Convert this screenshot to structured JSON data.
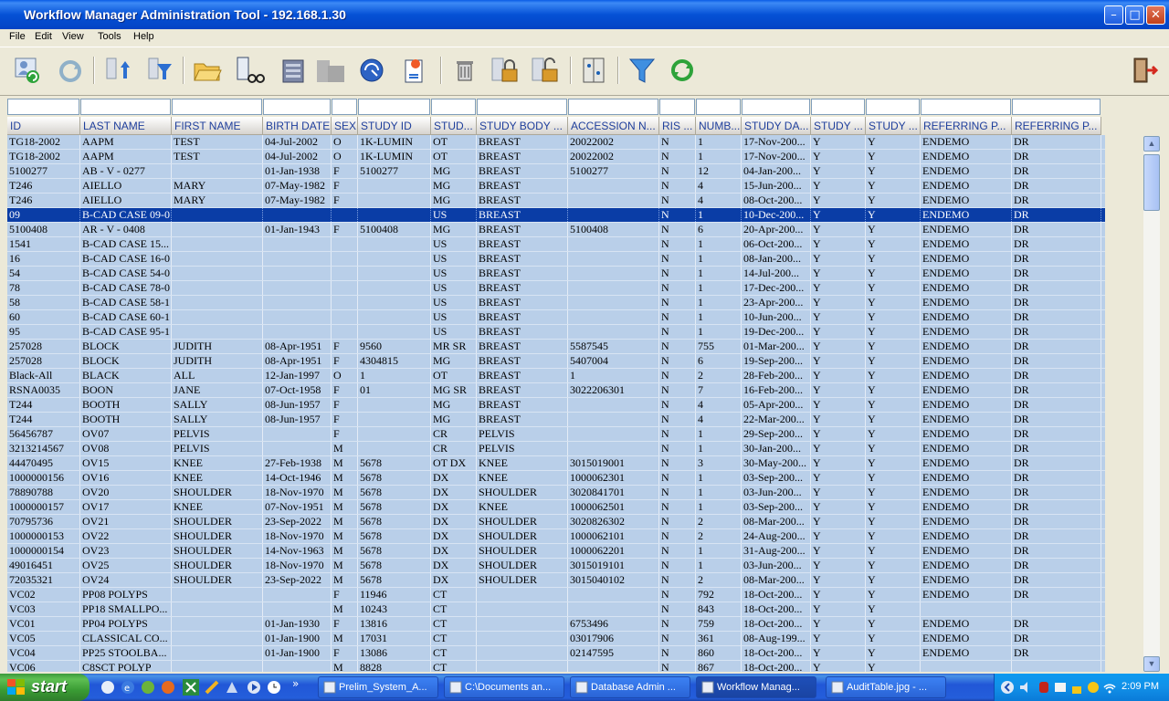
{
  "window": {
    "title": "Workflow Manager Administration Tool - 192.168.1.30"
  },
  "menu": [
    "File",
    "Edit",
    "View",
    "Tools",
    "Help"
  ],
  "toolbar_icons": [
    "user-refresh-icon",
    "refresh-icon",
    "sort-up-icon",
    "filter-user-icon",
    "folder-open-icon",
    "search-list-icon",
    "server-icon",
    "server-disabled-icon",
    "network-icon",
    "document-new-icon",
    "trash-icon",
    "lock-icon",
    "unlock-icon",
    "panel-icon",
    "funnel-icon",
    "reload-icon",
    "exit-icon"
  ],
  "columns": [
    "ID",
    "LAST NAME",
    "FIRST NAME",
    "BIRTH DATE",
    "SEX",
    "STUDY ID",
    "STUD...",
    "STUDY BODY ...",
    "ACCESSION N...",
    "RIS ...",
    "NUMB...",
    "STUDY DA...",
    "STUDY ...",
    "STUDY ...",
    "REFERRING P...",
    "REFERRING P..."
  ],
  "rows": [
    [
      "TG18-2002",
      "AAPM",
      "TEST",
      "04-Jul-2002",
      "O",
      "1K-LUMIN",
      "OT",
      "BREAST",
      "20022002",
      "N",
      "1",
      "17-Nov-200...",
      "Y",
      "Y",
      "ENDEMO",
      "DR"
    ],
    [
      "TG18-2002",
      "AAPM",
      "TEST",
      "04-Jul-2002",
      "O",
      "1K-LUMIN",
      "OT",
      "BREAST",
      "20022002",
      "N",
      "1",
      "17-Nov-200...",
      "Y",
      "Y",
      "ENDEMO",
      "DR"
    ],
    [
      "5100277",
      "AB - V - 0277",
      "",
      "01-Jan-1938",
      "F",
      "5100277",
      "MG",
      "BREAST",
      "5100277",
      "N",
      "12",
      "04-Jan-200...",
      "Y",
      "Y",
      "ENDEMO",
      "DR"
    ],
    [
      "T246",
      "AIELLO",
      "MARY",
      "07-May-1982",
      "F",
      "",
      "MG",
      "BREAST",
      "",
      "N",
      "4",
      "15-Jun-200...",
      "Y",
      "Y",
      "ENDEMO",
      "DR"
    ],
    [
      "T246",
      "AIELLO",
      "MARY",
      "07-May-1982",
      "F",
      "",
      "MG",
      "BREAST",
      "",
      "N",
      "4",
      "08-Oct-200...",
      "Y",
      "Y",
      "ENDEMO",
      "DR"
    ],
    [
      "09",
      "B-CAD CASE 09-0",
      "",
      "",
      "",
      "",
      "US",
      "BREAST",
      "",
      "N",
      "1",
      "10-Dec-200...",
      "Y",
      "Y",
      "ENDEMO",
      "DR"
    ],
    [
      "5100408",
      "AR - V - 0408",
      "",
      "01-Jan-1943",
      "F",
      "5100408",
      "MG",
      "BREAST",
      "5100408",
      "N",
      "6",
      "20-Apr-200...",
      "Y",
      "Y",
      "ENDEMO",
      "DR"
    ],
    [
      "1541",
      "B-CAD CASE 15...",
      "",
      "",
      "",
      "",
      "US",
      "BREAST",
      "",
      "N",
      "1",
      "06-Oct-200...",
      "Y",
      "Y",
      "ENDEMO",
      "DR"
    ],
    [
      "16",
      "B-CAD CASE 16-0",
      "",
      "",
      "",
      "",
      "US",
      "BREAST",
      "",
      "N",
      "1",
      "08-Jan-200...",
      "Y",
      "Y",
      "ENDEMO",
      "DR"
    ],
    [
      "54",
      "B-CAD CASE 54-0",
      "",
      "",
      "",
      "",
      "US",
      "BREAST",
      "",
      "N",
      "1",
      "14-Jul-200...",
      "Y",
      "Y",
      "ENDEMO",
      "DR"
    ],
    [
      "78",
      "B-CAD CASE 78-0",
      "",
      "",
      "",
      "",
      "US",
      "BREAST",
      "",
      "N",
      "1",
      "17-Dec-200...",
      "Y",
      "Y",
      "ENDEMO",
      "DR"
    ],
    [
      "58",
      "B-CAD CASE 58-1",
      "",
      "",
      "",
      "",
      "US",
      "BREAST",
      "",
      "N",
      "1",
      "23-Apr-200...",
      "Y",
      "Y",
      "ENDEMO",
      "DR"
    ],
    [
      "60",
      "B-CAD CASE 60-1",
      "",
      "",
      "",
      "",
      "US",
      "BREAST",
      "",
      "N",
      "1",
      "10-Jun-200...",
      "Y",
      "Y",
      "ENDEMO",
      "DR"
    ],
    [
      "95",
      "B-CAD CASE 95-1",
      "",
      "",
      "",
      "",
      "US",
      "BREAST",
      "",
      "N",
      "1",
      "19-Dec-200...",
      "Y",
      "Y",
      "ENDEMO",
      "DR"
    ],
    [
      "257028",
      "BLOCK",
      "JUDITH",
      "08-Apr-1951",
      "F",
      "9560",
      "MR SR",
      "BREAST",
      "5587545",
      "N",
      "755",
      "01-Mar-200...",
      "Y",
      "Y",
      "ENDEMO",
      "DR"
    ],
    [
      "257028",
      "BLOCK",
      "JUDITH",
      "08-Apr-1951",
      "F",
      "4304815",
      "MG",
      "BREAST",
      "5407004",
      "N",
      "6",
      "19-Sep-200...",
      "Y",
      "Y",
      "ENDEMO",
      "DR"
    ],
    [
      "Black-All",
      "BLACK",
      "ALL",
      "12-Jan-1997",
      "O",
      "1",
      "OT",
      "BREAST",
      "1",
      "N",
      "2",
      "28-Feb-200...",
      "Y",
      "Y",
      "ENDEMO",
      "DR"
    ],
    [
      "RSNA0035",
      "BOON",
      "JANE",
      "07-Oct-1958",
      "F",
      "01",
      "MG SR",
      "BREAST",
      "3022206301",
      "N",
      "7",
      "16-Feb-200...",
      "Y",
      "Y",
      "ENDEMO",
      "DR"
    ],
    [
      "T244",
      "BOOTH",
      "SALLY",
      "08-Jun-1957",
      "F",
      "",
      "MG",
      "BREAST",
      "",
      "N",
      "4",
      "05-Apr-200...",
      "Y",
      "Y",
      "ENDEMO",
      "DR"
    ],
    [
      "T244",
      "BOOTH",
      "SALLY",
      "08-Jun-1957",
      "F",
      "",
      "MG",
      "BREAST",
      "",
      "N",
      "4",
      "22-Mar-200...",
      "Y",
      "Y",
      "ENDEMO",
      "DR"
    ],
    [
      "56456787",
      "OV07",
      "PELVIS",
      "",
      "F",
      "",
      "CR",
      "PELVIS",
      "",
      "N",
      "1",
      "29-Sep-200...",
      "Y",
      "Y",
      "ENDEMO",
      "DR"
    ],
    [
      "3213214567",
      "OV08",
      "PELVIS",
      "",
      "M",
      "",
      "CR",
      "PELVIS",
      "",
      "N",
      "1",
      "30-Jan-200...",
      "Y",
      "Y",
      "ENDEMO",
      "DR"
    ],
    [
      "44470495",
      "OV15",
      "KNEE",
      "27-Feb-1938",
      "M",
      "5678",
      "OT DX",
      "KNEE",
      "3015019001",
      "N",
      "3",
      "30-May-200...",
      "Y",
      "Y",
      "ENDEMO",
      "DR"
    ],
    [
      "1000000156",
      "OV16",
      "KNEE",
      "14-Oct-1946",
      "M",
      "5678",
      "DX",
      "KNEE",
      "1000062301",
      "N",
      "1",
      "03-Sep-200...",
      "Y",
      "Y",
      "ENDEMO",
      "DR"
    ],
    [
      "78890788",
      "OV20",
      "SHOULDER",
      "18-Nov-1970",
      "M",
      "5678",
      "DX",
      "SHOULDER",
      "3020841701",
      "N",
      "1",
      "03-Jun-200...",
      "Y",
      "Y",
      "ENDEMO",
      "DR"
    ],
    [
      "1000000157",
      "OV17",
      "KNEE",
      "07-Nov-1951",
      "M",
      "5678",
      "DX",
      "KNEE",
      "1000062501",
      "N",
      "1",
      "03-Sep-200...",
      "Y",
      "Y",
      "ENDEMO",
      "DR"
    ],
    [
      "70795736",
      "OV21",
      "SHOULDER",
      "23-Sep-2022",
      "M",
      "5678",
      "DX",
      "SHOULDER",
      "3020826302",
      "N",
      "2",
      "08-Mar-200...",
      "Y",
      "Y",
      "ENDEMO",
      "DR"
    ],
    [
      "1000000153",
      "OV22",
      "SHOULDER",
      "18-Nov-1970",
      "M",
      "5678",
      "DX",
      "SHOULDER",
      "1000062101",
      "N",
      "2",
      "24-Aug-200...",
      "Y",
      "Y",
      "ENDEMO",
      "DR"
    ],
    [
      "1000000154",
      "OV23",
      "SHOULDER",
      "14-Nov-1963",
      "M",
      "5678",
      "DX",
      "SHOULDER",
      "1000062201",
      "N",
      "1",
      "31-Aug-200...",
      "Y",
      "Y",
      "ENDEMO",
      "DR"
    ],
    [
      "49016451",
      "OV25",
      "SHOULDER",
      "18-Nov-1970",
      "M",
      "5678",
      "DX",
      "SHOULDER",
      "3015019101",
      "N",
      "1",
      "03-Jun-200...",
      "Y",
      "Y",
      "ENDEMO",
      "DR"
    ],
    [
      "72035321",
      "OV24",
      "SHOULDER",
      "23-Sep-2022",
      "M",
      "5678",
      "DX",
      "SHOULDER",
      "3015040102",
      "N",
      "2",
      "08-Mar-200...",
      "Y",
      "Y",
      "ENDEMO",
      "DR"
    ],
    [
      "VC02",
      "PP08 POLYPS",
      "",
      "",
      "F",
      "11946",
      "CT",
      "",
      "",
      "N",
      "792",
      "18-Oct-200...",
      "Y",
      "Y",
      "ENDEMO",
      "DR"
    ],
    [
      "VC03",
      "PP18 SMALLPO...",
      "",
      "",
      "M",
      "10243",
      "CT",
      "",
      "",
      "N",
      "843",
      "18-Oct-200...",
      "Y",
      "Y",
      "",
      ""
    ],
    [
      "VC01",
      "PP04 POLYPS",
      "",
      "01-Jan-1930",
      "F",
      "13816",
      "CT",
      "",
      "6753496",
      "N",
      "759",
      "18-Oct-200...",
      "Y",
      "Y",
      "ENDEMO",
      "DR"
    ],
    [
      "VC05",
      "CLASSICAL CO...",
      "",
      "01-Jan-1900",
      "M",
      "17031",
      "CT",
      "",
      "03017906",
      "N",
      "361",
      "08-Aug-199...",
      "Y",
      "Y",
      "ENDEMO",
      "DR"
    ],
    [
      "VC04",
      "PP25 STOOLBA...",
      "",
      "01-Jan-1900",
      "F",
      "13086",
      "CT",
      "",
      "02147595",
      "N",
      "860",
      "18-Oct-200...",
      "Y",
      "Y",
      "ENDEMO",
      "DR"
    ],
    [
      "VC06",
      "C8SCT POLYP",
      "",
      "",
      "M",
      "8828",
      "CT",
      "",
      "",
      "N",
      "867",
      "18-Oct-200...",
      "Y",
      "Y",
      "",
      ""
    ]
  ],
  "selected_row_index": 5,
  "taskbar": {
    "start_label": "start",
    "tasks": [
      "Prelim_System_A...",
      "C:\\Documents an...",
      "Database Admin ...",
      "Workflow Manag...",
      "AuditTable.jpg - ..."
    ],
    "active_task_index": 3,
    "clock": "2:09 PM"
  }
}
